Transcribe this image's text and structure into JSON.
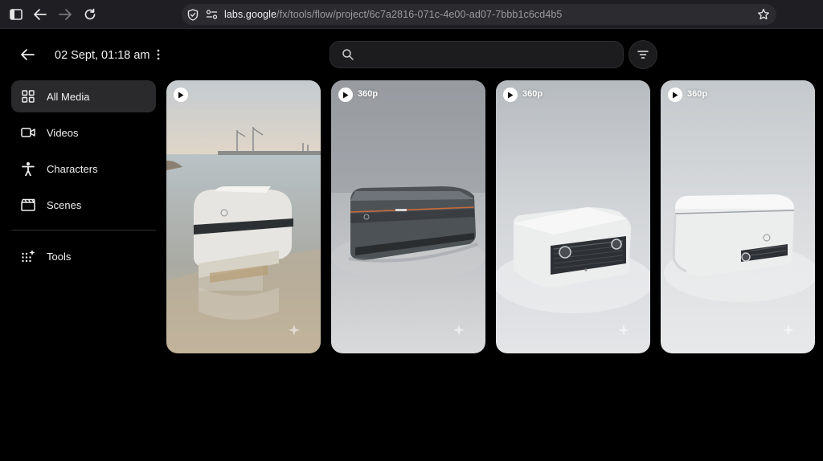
{
  "browser": {
    "url_host": "labs.google",
    "url_path": "/fx/tools/flow/project/6c7a2816-071c-4e00-ad07-7bbb1c6cd4b5"
  },
  "header": {
    "title": "02 Sept, 01:18 am",
    "search_placeholder": ""
  },
  "sidebar": {
    "items": [
      {
        "label": "All Media",
        "icon": "grid-icon",
        "active": true
      },
      {
        "label": "Videos",
        "icon": "video-icon",
        "active": false
      },
      {
        "label": "Characters",
        "icon": "person-icon",
        "active": false
      },
      {
        "label": "Scenes",
        "icon": "clapperboard-icon",
        "active": false
      },
      {
        "label": "Tools",
        "icon": "sparkle-grid-icon",
        "active": false
      }
    ]
  },
  "media": [
    {
      "resolution": "",
      "scene": "robot on water by port"
    },
    {
      "resolution": "360p",
      "scene": "dark grey robot in studio"
    },
    {
      "resolution": "360p",
      "scene": "white robot with grille"
    },
    {
      "resolution": "360p",
      "scene": "white robot box"
    }
  ],
  "colors": {
    "background": "#000000",
    "chrome": "#1f1f23",
    "active_item": "#2a2a2c",
    "text": "#f0f0f0"
  }
}
